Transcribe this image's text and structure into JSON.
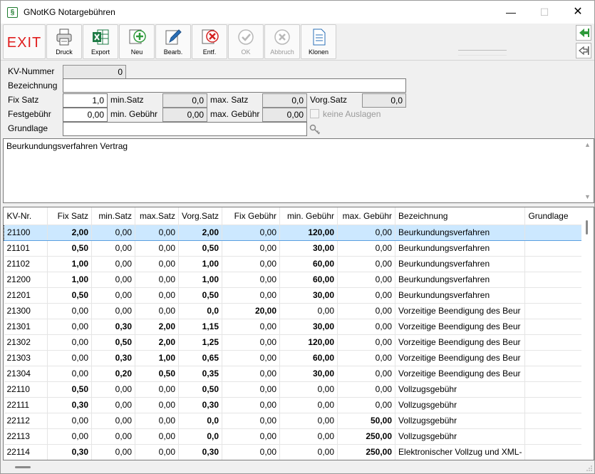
{
  "window": {
    "title": "GNotKG Notargebühren",
    "app_icon": "§",
    "controls": {
      "minimize": "—",
      "maximize": "☐",
      "close": "✕"
    }
  },
  "toolbar": {
    "exit": "EXIT",
    "buttons": [
      {
        "label": "Druck",
        "icon": "printer-icon"
      },
      {
        "label": "Export",
        "icon": "excel-icon"
      },
      {
        "label": "Neu",
        "icon": "add-icon"
      },
      {
        "label": "Bearb.",
        "icon": "edit-icon"
      },
      {
        "label": "Entf.",
        "icon": "delete-icon"
      },
      {
        "label": "OK",
        "icon": "check-icon"
      },
      {
        "label": "Abbruch",
        "icon": "cancel-icon"
      },
      {
        "label": "Klonen",
        "icon": "document-icon"
      }
    ]
  },
  "form": {
    "kv_nummer_label": "KV-Nummer",
    "kv_nummer_value": "0",
    "bezeichnung_label": "Bezeichnung",
    "bezeichnung_value": "",
    "fix_satz_label": "Fix Satz",
    "fix_satz_value": "1,0",
    "min_satz_label": "min.Satz",
    "min_satz_value": "0,0",
    "max_satz_label": "max. Satz",
    "max_satz_value": "0,0",
    "vorg_satz_label": "Vorg.Satz",
    "vorg_satz_value": "0,0",
    "festgebuehr_label": "Festgebühr",
    "festgebuehr_value": "0,00",
    "min_gebuehr_label": "min. Gebühr",
    "min_gebuehr_value": "0,00",
    "max_gebuehr_label": "max. Gebühr",
    "max_gebuehr_value": "0,00",
    "keine_auslagen_label": "keine Auslagen",
    "grundlage_label": "Grundlage",
    "grundlage_value": ""
  },
  "memo": {
    "text": "Beurkundungsverfahren Vertrag"
  },
  "table": {
    "columns": [
      "KV-Nr.",
      "Fix Satz",
      "min.Satz",
      "max.Satz",
      "Vorg.Satz",
      "Fix Gebühr",
      "min. Gebühr",
      "max. Gebühr",
      "Bezeichnung",
      "Grundlage"
    ],
    "rows": [
      {
        "kv": "21100",
        "fix": "2,00",
        "min": "0,00",
        "max": "0,00",
        "vorg": "2,00",
        "fixg": "0,00",
        "ming": "120,00",
        "maxg": "0,00",
        "bez": "Beurkundungsverfahren",
        "grund": "",
        "selected": true,
        "bold": [
          "fix",
          "vorg",
          "ming"
        ]
      },
      {
        "kv": "21101",
        "fix": "0,50",
        "min": "0,00",
        "max": "0,00",
        "vorg": "0,50",
        "fixg": "0,00",
        "ming": "30,00",
        "maxg": "0,00",
        "bez": "Beurkundungsverfahren",
        "grund": "",
        "bold": [
          "fix",
          "vorg",
          "ming"
        ]
      },
      {
        "kv": "21102",
        "fix": "1,00",
        "min": "0,00",
        "max": "0,00",
        "vorg": "1,00",
        "fixg": "0,00",
        "ming": "60,00",
        "maxg": "0,00",
        "bez": "Beurkundungsverfahren",
        "grund": "",
        "bold": [
          "fix",
          "vorg",
          "ming"
        ]
      },
      {
        "kv": "21200",
        "fix": "1,00",
        "min": "0,00",
        "max": "0,00",
        "vorg": "1,00",
        "fixg": "0,00",
        "ming": "60,00",
        "maxg": "0,00",
        "bez": "Beurkundungsverfahren",
        "grund": "",
        "bold": [
          "fix",
          "vorg",
          "ming"
        ]
      },
      {
        "kv": "21201",
        "fix": "0,50",
        "min": "0,00",
        "max": "0,00",
        "vorg": "0,50",
        "fixg": "0,00",
        "ming": "30,00",
        "maxg": "0,00",
        "bez": "Beurkundungsverfahren",
        "grund": "",
        "bold": [
          "fix",
          "vorg",
          "ming"
        ]
      },
      {
        "kv": "21300",
        "fix": "0,00",
        "min": "0,00",
        "max": "0,00",
        "vorg": "0,0",
        "fixg": "20,00",
        "ming": "0,00",
        "maxg": "0,00",
        "bez": "Vorzeitige Beendigung des Beur",
        "grund": "",
        "bold": [
          "vorg",
          "fixg"
        ]
      },
      {
        "kv": "21301",
        "fix": "0,00",
        "min": "0,30",
        "max": "2,00",
        "vorg": "1,15",
        "fixg": "0,00",
        "ming": "30,00",
        "maxg": "0,00",
        "bez": "Vorzeitige Beendigung des Beur",
        "grund": "",
        "bold": [
          "min",
          "max",
          "vorg",
          "ming"
        ]
      },
      {
        "kv": "21302",
        "fix": "0,00",
        "min": "0,50",
        "max": "2,00",
        "vorg": "1,25",
        "fixg": "0,00",
        "ming": "120,00",
        "maxg": "0,00",
        "bez": "Vorzeitige Beendigung des Beur",
        "grund": "",
        "bold": [
          "min",
          "max",
          "vorg",
          "ming"
        ]
      },
      {
        "kv": "21303",
        "fix": "0,00",
        "min": "0,30",
        "max": "1,00",
        "vorg": "0,65",
        "fixg": "0,00",
        "ming": "60,00",
        "maxg": "0,00",
        "bez": "Vorzeitige Beendigung des Beur",
        "grund": "",
        "bold": [
          "min",
          "max",
          "vorg",
          "ming"
        ]
      },
      {
        "kv": "21304",
        "fix": "0,00",
        "min": "0,20",
        "max": "0,50",
        "vorg": "0,35",
        "fixg": "0,00",
        "ming": "30,00",
        "maxg": "0,00",
        "bez": "Vorzeitige Beendigung des Beur",
        "grund": "",
        "bold": [
          "min",
          "max",
          "vorg",
          "ming"
        ]
      },
      {
        "kv": "22110",
        "fix": "0,50",
        "min": "0,00",
        "max": "0,00",
        "vorg": "0,50",
        "fixg": "0,00",
        "ming": "0,00",
        "maxg": "0,00",
        "bez": "Vollzugsgebühr",
        "grund": "",
        "bold": [
          "fix",
          "vorg"
        ]
      },
      {
        "kv": "22111",
        "fix": "0,30",
        "min": "0,00",
        "max": "0,00",
        "vorg": "0,30",
        "fixg": "0,00",
        "ming": "0,00",
        "maxg": "0,00",
        "bez": "Vollzugsgebühr",
        "grund": "",
        "bold": [
          "fix",
          "vorg"
        ]
      },
      {
        "kv": "22112",
        "fix": "0,00",
        "min": "0,00",
        "max": "0,00",
        "vorg": "0,0",
        "fixg": "0,00",
        "ming": "0,00",
        "maxg": "50,00",
        "bez": "Vollzugsgebühr",
        "grund": "",
        "bold": [
          "vorg",
          "maxg"
        ]
      },
      {
        "kv": "22113",
        "fix": "0,00",
        "min": "0,00",
        "max": "0,00",
        "vorg": "0,0",
        "fixg": "0,00",
        "ming": "0,00",
        "maxg": "250,00",
        "bez": "Vollzugsgebühr",
        "grund": "",
        "bold": [
          "vorg",
          "maxg"
        ]
      },
      {
        "kv": "22114",
        "fix": "0,30",
        "min": "0,00",
        "max": "0,00",
        "vorg": "0,30",
        "fixg": "0,00",
        "ming": "0,00",
        "maxg": "250,00",
        "bez": "Elektronischer Vollzug und XML-",
        "grund": "",
        "bold": [
          "fix",
          "vorg",
          "maxg"
        ]
      }
    ]
  },
  "colors": {
    "exit_red": "#e01d1d",
    "selection": "#cce8ff",
    "nav_green": "#2e9a3a"
  }
}
